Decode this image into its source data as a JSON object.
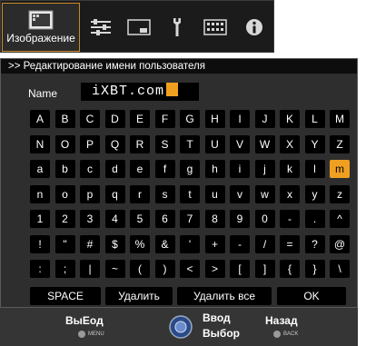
{
  "menu": {
    "active_tab_label": "Изображение",
    "tabs": [
      {
        "icon": "picture-icon"
      },
      {
        "icon": "equalizer-icon"
      },
      {
        "icon": "screen-icon"
      },
      {
        "icon": "wrench-icon"
      },
      {
        "icon": "keyboard-icon"
      },
      {
        "icon": "info-icon"
      }
    ]
  },
  "header": {
    "title": ">> Редактирование имени пользователя"
  },
  "name": {
    "label": "Name",
    "value": "iXBT.com"
  },
  "keyboard": {
    "rows": [
      [
        "A",
        "B",
        "C",
        "D",
        "E",
        "F",
        "G",
        "H",
        "I",
        "J",
        "K",
        "L",
        "M"
      ],
      [
        "N",
        "O",
        "P",
        "Q",
        "R",
        "S",
        "T",
        "U",
        "V",
        "W",
        "X",
        "Y",
        "Z"
      ],
      [
        "a",
        "b",
        "c",
        "d",
        "e",
        "f",
        "g",
        "h",
        "i",
        "j",
        "k",
        "l",
        "m"
      ],
      [
        "n",
        "o",
        "p",
        "q",
        "r",
        "s",
        "t",
        "u",
        "v",
        "w",
        "x",
        "y",
        "z"
      ],
      [
        "1",
        "2",
        "3",
        "4",
        "5",
        "6",
        "7",
        "8",
        "9",
        "0",
        "-",
        ".",
        "^"
      ],
      [
        "!",
        "\"",
        "#",
        "$",
        "%",
        "&",
        "'",
        "+",
        "-",
        "/",
        "=",
        "?",
        "@"
      ],
      [
        ":",
        ";",
        "|",
        "~",
        "(",
        ")",
        "<",
        ">",
        "[",
        "]",
        "{",
        "}",
        "\\"
      ]
    ],
    "selected": {
      "row": 2,
      "col": 12
    },
    "space": "SPACE",
    "delete": "Удалить",
    "delete_all": "Удалить все",
    "ok": "OK"
  },
  "footer": {
    "exit_label": "ВыЕод",
    "exit_sub": "MENU",
    "enter_label": "Ввод",
    "select_label": "Выбор",
    "back_label": "Назад",
    "back_sub": "BACK"
  },
  "colors": {
    "accent": "#f0a020",
    "key_bg": "#000000",
    "panel_bg": "#2e2e2e"
  }
}
